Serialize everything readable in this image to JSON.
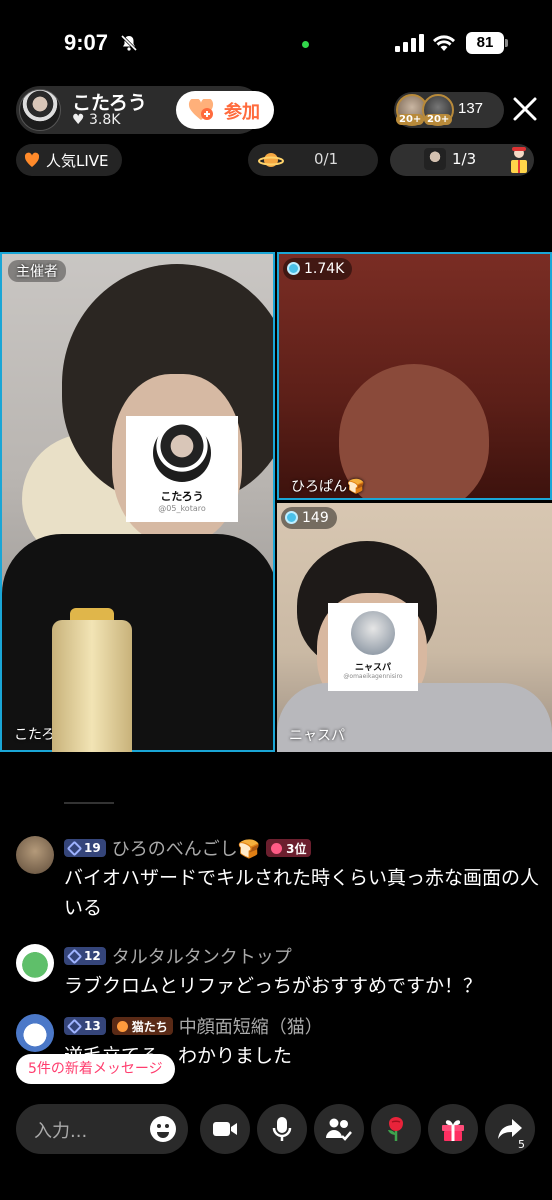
{
  "status": {
    "time": "9:07",
    "battery": "81"
  },
  "header": {
    "host_name": "こたろう",
    "host_likes": "♥ 3.8K",
    "join_label": "参加",
    "viewer_badge_1": "20+",
    "viewer_badge_2": "20+",
    "viewer_count": "137",
    "ranking_label": "人気LIVE",
    "planet_value": "0/1",
    "guest_value": "1/3"
  },
  "tiles": {
    "host": {
      "role_tag": "主催者",
      "name": "こたろう",
      "card_name": "こたろう",
      "card_handle": "@05_kotaro"
    },
    "guest1": {
      "gems": "1.74K",
      "name": "ひろぱん🍞"
    },
    "guest2": {
      "gems": "149",
      "name": "ニャスパ",
      "card_name": "ニャスパ",
      "card_handle": "@omaeikagennisiro"
    }
  },
  "comments": [
    {
      "level": "19",
      "user": "ひろのべんごし🍞",
      "rank": "3位",
      "text": "バイオハザードでキルされた時くらい真っ赤な画面の人いる"
    },
    {
      "level": "12",
      "user": "タルタルタンクトップ",
      "text": "ラブクロムとリファどっちがおすすめですか！？"
    },
    {
      "level": "13",
      "fan": "猫たち",
      "user": "中顔面短縮（猫）",
      "text": "逆毛立てる。わかりました"
    }
  ],
  "new_messages": "5件の新着メッセージ",
  "bottom": {
    "input_placeholder": "入力...",
    "share_count": "5"
  },
  "colors": {
    "accent": "#ff3d6e",
    "tile_border": "#1aa6d6",
    "join_text": "#ff6b3d"
  }
}
